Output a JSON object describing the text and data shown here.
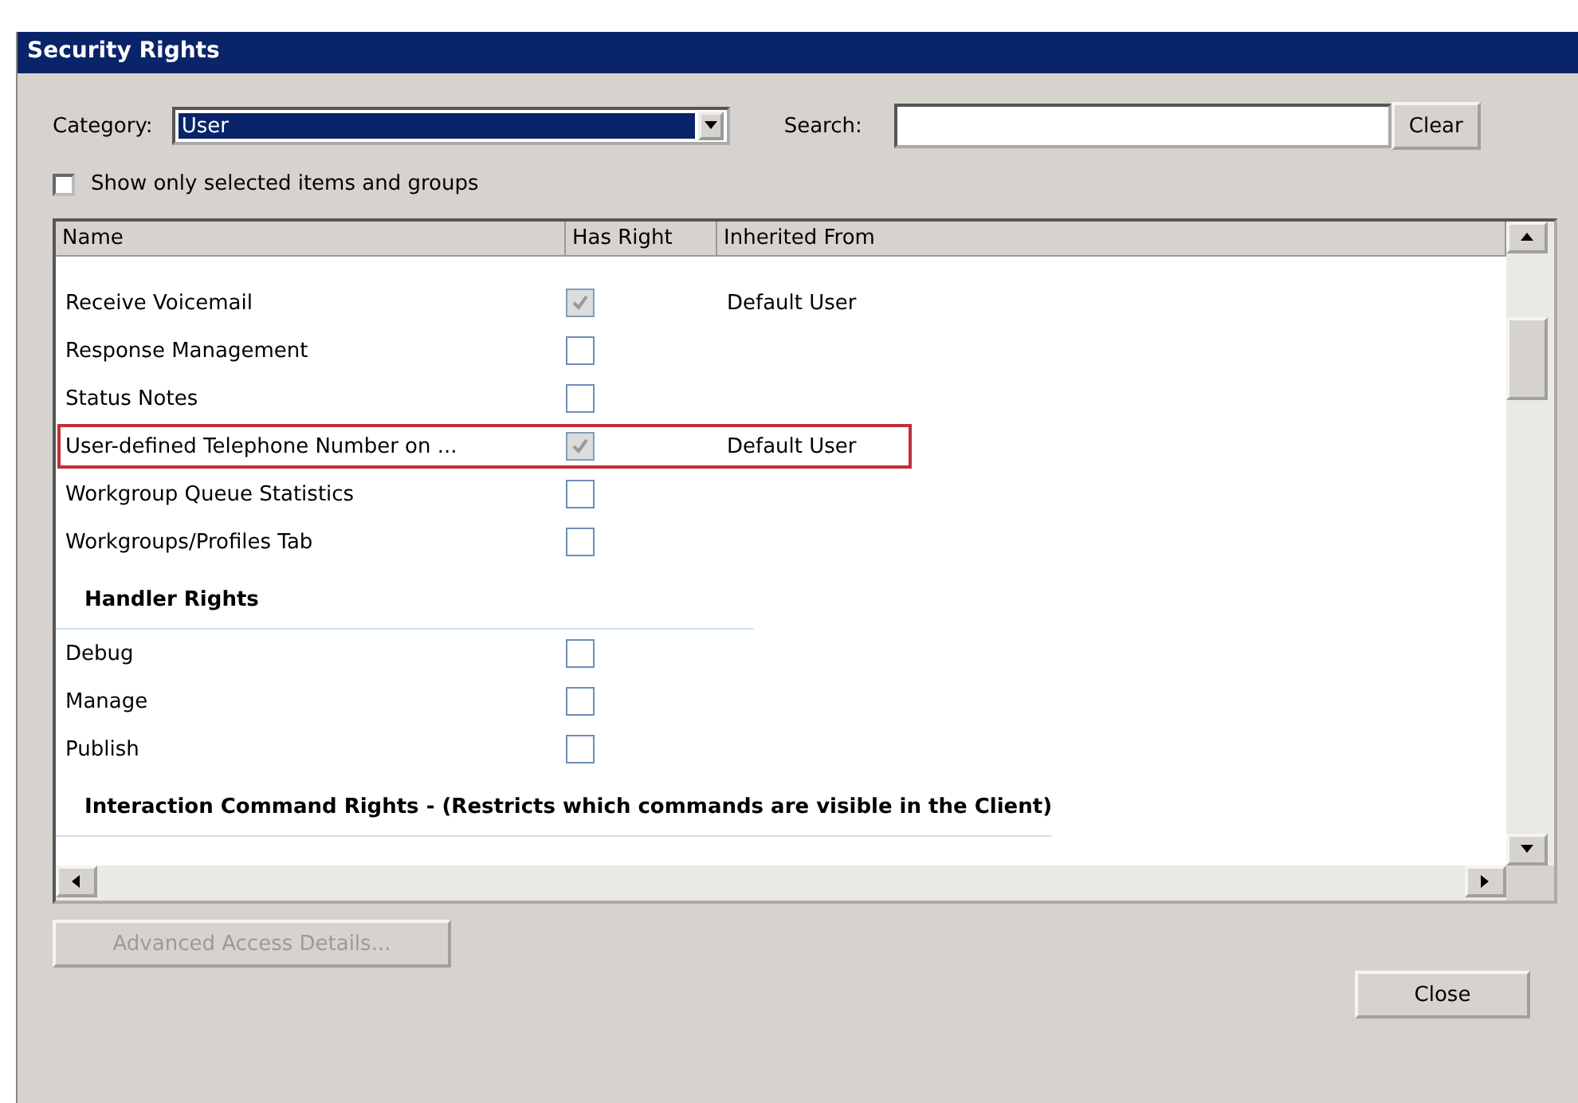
{
  "window": {
    "title": "Security Rights"
  },
  "category": {
    "label": "Category:",
    "value": "User"
  },
  "search": {
    "label": "Search:"
  },
  "clear_button": "Clear",
  "show_selected": {
    "label": "Show only selected items and groups",
    "checked": false
  },
  "table": {
    "columns": [
      "Name",
      "Has Right",
      "Inherited From"
    ],
    "groups": [
      {
        "rows": [
          {
            "name": "Receive Voicemail",
            "checked": true,
            "disabled": true,
            "inherited_from": "Default User",
            "highlighted": false
          },
          {
            "name": "Response Management",
            "checked": false,
            "disabled": false,
            "highlighted": false
          },
          {
            "name": "Status Notes",
            "checked": false,
            "disabled": false,
            "highlighted": false
          },
          {
            "name": "User-defined Telephone Number on ...",
            "checked": true,
            "disabled": true,
            "inherited_from": "Default User",
            "highlighted": true
          },
          {
            "name": "Workgroup Queue Statistics",
            "checked": false,
            "disabled": false,
            "highlighted": false
          },
          {
            "name": "Workgroups/Profiles Tab",
            "checked": false,
            "disabled": false,
            "highlighted": false
          }
        ]
      },
      {
        "title": "Handler Rights",
        "rows": [
          {
            "name": "Debug",
            "checked": false,
            "disabled": false,
            "highlighted": false
          },
          {
            "name": "Manage",
            "checked": false,
            "disabled": false,
            "highlighted": false
          },
          {
            "name": "Publish",
            "checked": false,
            "disabled": false,
            "highlighted": false
          }
        ]
      },
      {
        "title": "Interaction Command Rights - (Restricts which commands are visible in the Client)"
      }
    ]
  },
  "advanced_button": {
    "label": "Advanced Access Details...",
    "disabled": true
  },
  "close_button": "Close"
}
